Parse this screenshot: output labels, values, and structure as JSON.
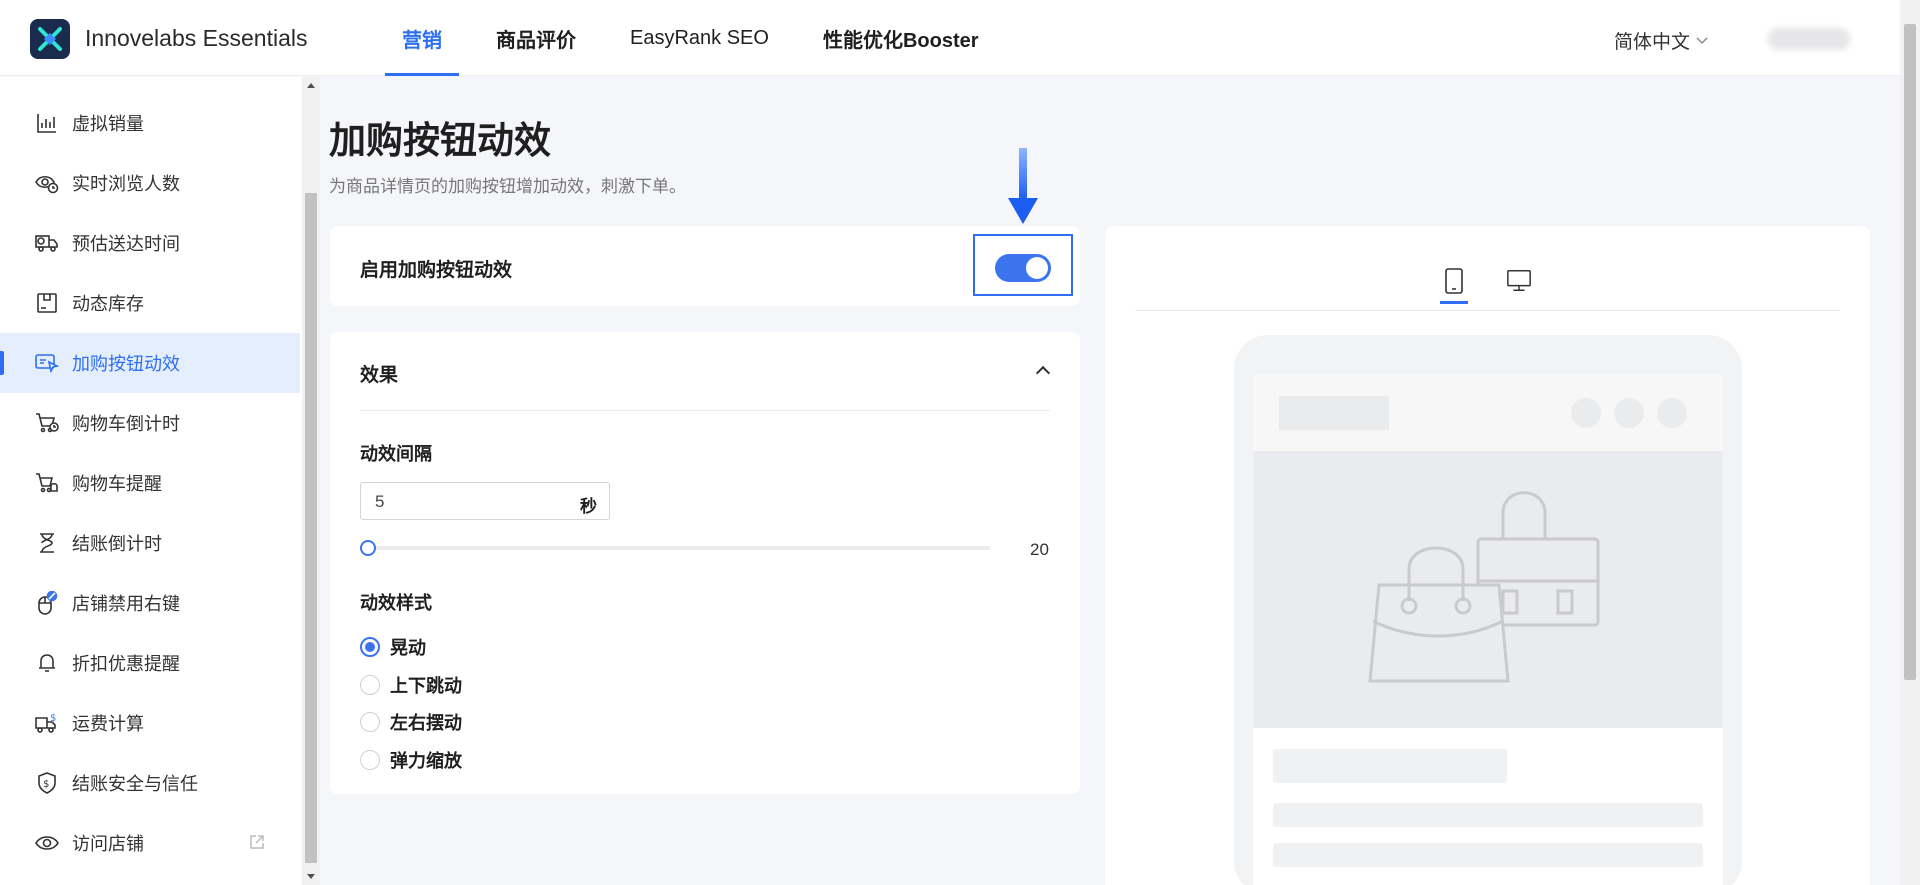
{
  "header": {
    "brand": "Innovelabs Essentials",
    "nav": [
      {
        "label": "营销",
        "active": true
      },
      {
        "label": "商品评价",
        "active": false
      },
      {
        "label": "EasyRank SEO",
        "active": false
      },
      {
        "label": "性能优化Booster",
        "active": false
      }
    ],
    "language": "简体中文"
  },
  "sidebar": {
    "items": [
      {
        "label": "虚拟销量",
        "icon": "bar-chart-icon"
      },
      {
        "label": "实时浏览人数",
        "icon": "eye-clock-icon"
      },
      {
        "label": "预估送达时间",
        "icon": "delivery-truck-icon"
      },
      {
        "label": "动态库存",
        "icon": "inventory-box-icon"
      },
      {
        "label": "加购按钮动效",
        "icon": "button-cursor-icon",
        "active": true
      },
      {
        "label": "购物车倒计时",
        "icon": "cart-clock-icon"
      },
      {
        "label": "购物车提醒",
        "icon": "cart-bell-icon"
      },
      {
        "label": "结账倒计时",
        "icon": "hourglass-icon"
      },
      {
        "label": "店铺禁用右键",
        "icon": "mouse-block-icon"
      },
      {
        "label": "折扣优惠提醒",
        "icon": "bell-icon"
      },
      {
        "label": "运费计算",
        "icon": "shipping-dollar-icon"
      },
      {
        "label": "结账安全与信任",
        "icon": "shield-dollar-icon"
      },
      {
        "label": "访问店铺",
        "icon": "eye-icon",
        "external": true
      }
    ]
  },
  "main": {
    "title": "加购按钮动效",
    "subtitle": "为商品详情页的加购按钮增加动效，刺激下单。",
    "enable": {
      "label": "启用加购按钮动效",
      "enabled": true
    },
    "effect": {
      "heading": "效果",
      "interval_label": "动效间隔",
      "interval_value": "5",
      "interval_unit": "秒",
      "slider_min": 5,
      "slider_max": 20,
      "slider_value": 5,
      "slider_max_label": "20",
      "style_label": "动效样式",
      "styles": [
        {
          "label": "晃动",
          "checked": true
        },
        {
          "label": "上下跳动",
          "checked": false
        },
        {
          "label": "左右摆动",
          "checked": false
        },
        {
          "label": "弹力缩放",
          "checked": false
        }
      ]
    },
    "preview": {
      "devices": [
        {
          "name": "mobile-device-icon",
          "active": true
        },
        {
          "name": "desktop-monitor-icon",
          "active": false
        }
      ]
    }
  },
  "colors": {
    "accent": "#2d6ff0",
    "toggle": "#3c74ee",
    "active_bg": "#e5eefd"
  }
}
